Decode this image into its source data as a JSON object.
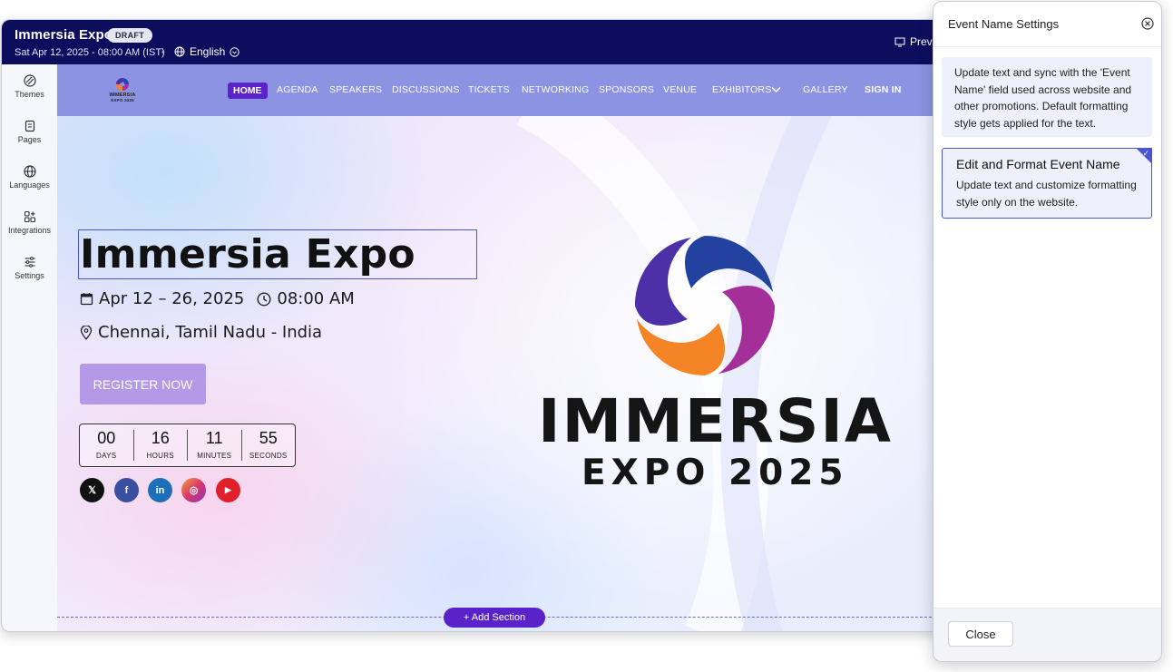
{
  "app": {
    "title": "Immersia Expo",
    "status_badge": "DRAFT",
    "datetime": "Sat Apr 12, 2025 - 08:00 AM (IST)",
    "separator": "•",
    "language": "English",
    "preview_label": "Previ"
  },
  "sidebar": {
    "items": [
      {
        "label": "Themes",
        "icon": "palette-icon"
      },
      {
        "label": "Pages",
        "icon": "pages-icon"
      },
      {
        "label": "Languages",
        "icon": "globe-icon"
      },
      {
        "label": "Integrations",
        "icon": "integrations-icon"
      },
      {
        "label": "Settings",
        "icon": "sliders-icon"
      }
    ]
  },
  "site_nav": {
    "logo_text_1": "IMMERSIA",
    "logo_text_2": "EXPO 2025",
    "items": [
      "HOME",
      "AGENDA",
      "SPEAKERS",
      "DISCUSSIONS",
      "TICKETS",
      "NETWORKING",
      "SPONSORS",
      "VENUE",
      "EXHIBITORS",
      "GALLERY",
      "SIGN IN"
    ],
    "active": "HOME"
  },
  "hero": {
    "title": "Immersia Expo",
    "date_range": "Apr 12 – 26, 2025",
    "time": "08:00 AM",
    "location": "Chennai, Tamil Nadu - India",
    "register_label": "REGISTER NOW",
    "countdown": [
      {
        "value": "00",
        "label": "DAYS"
      },
      {
        "value": "16",
        "label": "HOURS"
      },
      {
        "value": "11",
        "label": "MINUTES"
      },
      {
        "value": "55",
        "label": "SECONDS"
      }
    ],
    "social": [
      {
        "name": "x",
        "glyph": "𝕏",
        "color": "#111111"
      },
      {
        "name": "facebook",
        "glyph": "f",
        "color": "#3b4fa0"
      },
      {
        "name": "linkedin",
        "glyph": "in",
        "color": "#1d6fb8"
      },
      {
        "name": "instagram",
        "glyph": "◎",
        "color": "#d8366b"
      },
      {
        "name": "youtube",
        "glyph": "▶",
        "color": "#e0202a"
      }
    ],
    "logo_word": "IMMERSIA",
    "logo_sub": "EXPO 2025"
  },
  "canvas": {
    "add_section_label": "+ Add Section"
  },
  "panel": {
    "title": "Event Name Settings",
    "option1_text": "Update text and sync with the 'Event Name' field used across website and other promotions. Default formatting style gets applied for the text.",
    "option2_title": "Edit and Format Event Name",
    "option2_text": "Update text and customize formatting style only on the website.",
    "close_label": "Close"
  },
  "colors": {
    "topbar": "#0d0d5e",
    "accent": "#5a22c9",
    "nav_bg": "#8b93e2",
    "selected_border": "#4b56d4"
  }
}
